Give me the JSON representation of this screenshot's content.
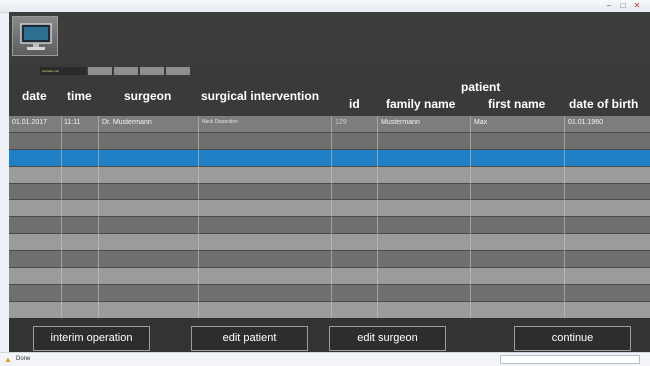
{
  "window": {
    "minimize_glyph": "–",
    "maximize_glyph": "□",
    "close_glyph": "✕"
  },
  "tabs": [
    {
      "label": "operation list",
      "active": true
    },
    {
      "label": "",
      "active": false
    },
    {
      "label": "",
      "active": false
    },
    {
      "label": "",
      "active": false
    },
    {
      "label": "",
      "active": false
    }
  ],
  "table": {
    "group_header": "patient",
    "columns": {
      "date": "date",
      "time": "time",
      "surgeon": "surgeon",
      "surgical_intervention": "surgical intervention",
      "id": "id",
      "family_name": "family name",
      "first_name": "first name",
      "date_of_birth": "date of birth"
    },
    "rows": [
      {
        "date": "01.01.2017",
        "time": "11:11",
        "surgeon": "Dr. Mustermann",
        "surgical_intervention": "Neck Dissection",
        "id": "129",
        "family_name": "Mustermann",
        "first_name": "Max",
        "date_of_birth": "01.01.1960"
      }
    ],
    "selected_row_index": 2,
    "empty_row_count": 11
  },
  "buttons": {
    "interim_operation": "interim operation",
    "edit_patient": "edit patient",
    "edit_surgeon": "edit surgeon",
    "continue": "continue"
  },
  "statusbar": {
    "icon": "warning-icon",
    "text": "Done",
    "field_text": ""
  },
  "colors": {
    "selection": "#1e7fc4",
    "header_bg": "#3d3d3d",
    "row_light": "#9b9b9b",
    "row_dark": "#6f6f6f"
  }
}
